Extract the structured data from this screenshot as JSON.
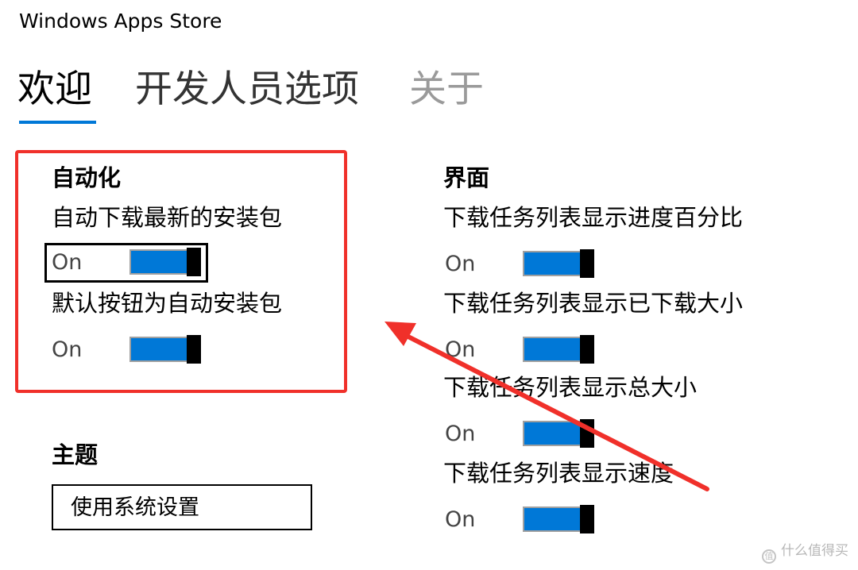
{
  "app": {
    "title": "Windows Apps Store"
  },
  "tabs": [
    {
      "label": "欢迎",
      "selected": true
    },
    {
      "label": "开发人员选项",
      "selected": false
    },
    {
      "label": "关于",
      "selected": false
    }
  ],
  "automation": {
    "title": "自动化",
    "settings": [
      {
        "label": "自动下载最新的安装包",
        "state": "On",
        "focused": true
      },
      {
        "label": "默认按钮为自动安装包",
        "state": "On",
        "focused": false
      }
    ]
  },
  "interface": {
    "title": "界面",
    "settings": [
      {
        "label": "下载任务列表显示进度百分比",
        "state": "On"
      },
      {
        "label": "下载任务列表显示已下载大小",
        "state": "On"
      },
      {
        "label": "下载任务列表显示总大小",
        "state": "On"
      },
      {
        "label": "下载任务列表显示速度",
        "state": "On"
      }
    ]
  },
  "theme": {
    "title": "主题",
    "selected_value": "使用系统设置"
  },
  "watermark": {
    "text": "什么值得买",
    "logo_glyph": "值"
  },
  "colors": {
    "accent": "#0078d7",
    "annotation_red": "#f0302a",
    "inactive_tab": "#9a9a9a"
  }
}
